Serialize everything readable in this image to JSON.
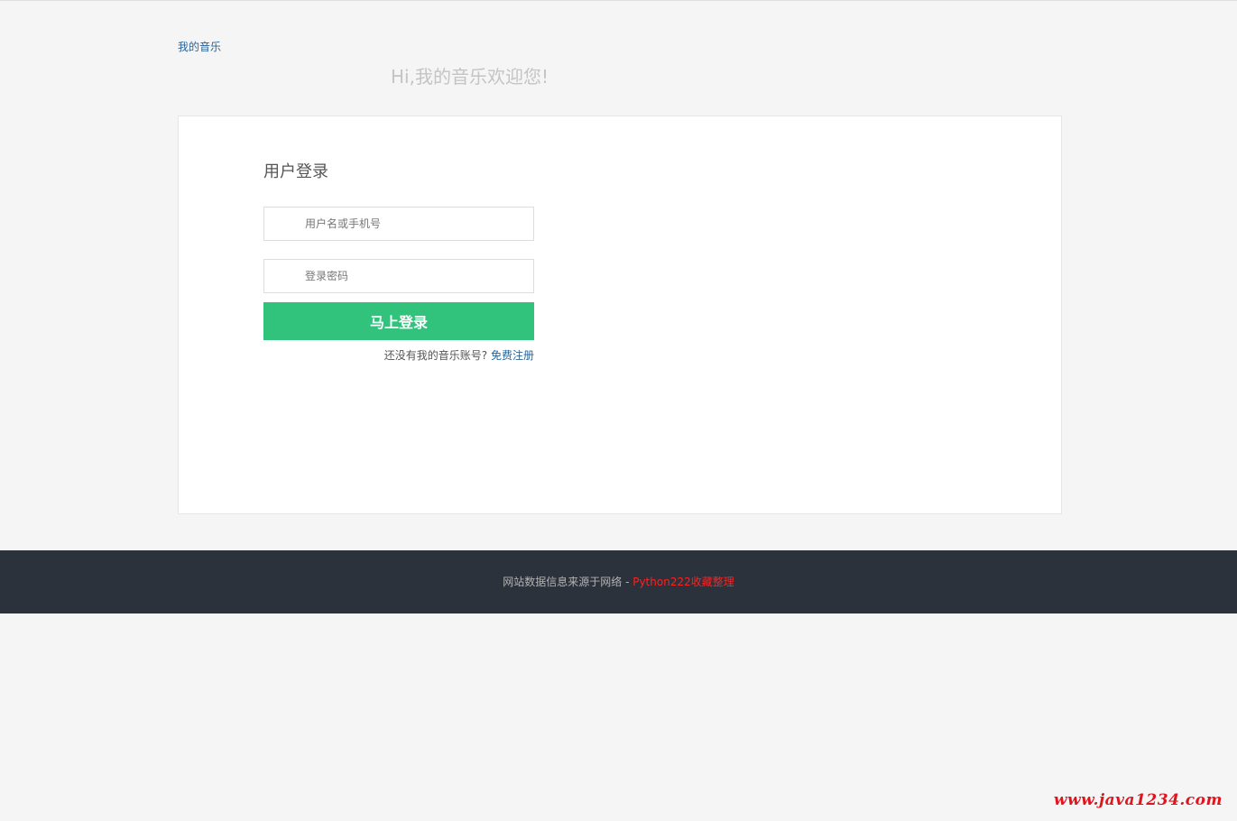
{
  "header": {
    "brand_link": "我的音乐",
    "welcome": "Hi,我的音乐欢迎您!"
  },
  "login": {
    "title": "用户登录",
    "username_placeholder": "用户名或手机号",
    "password_placeholder": "登录密码",
    "submit_label": "马上登录",
    "register_prompt": "还没有我的音乐账号?",
    "register_link": "免费注册"
  },
  "footer": {
    "text": "网站数据信息来源于网络 - ",
    "highlight": "Python222收藏整理"
  },
  "watermark": {
    "text": "www.java1234.com"
  },
  "colors": {
    "accent_green": "#31c27c",
    "link_blue": "#2a6496",
    "footer_bg": "#2c323b",
    "footer_highlight": "#ff2020",
    "watermark_red": "#e0141e"
  }
}
